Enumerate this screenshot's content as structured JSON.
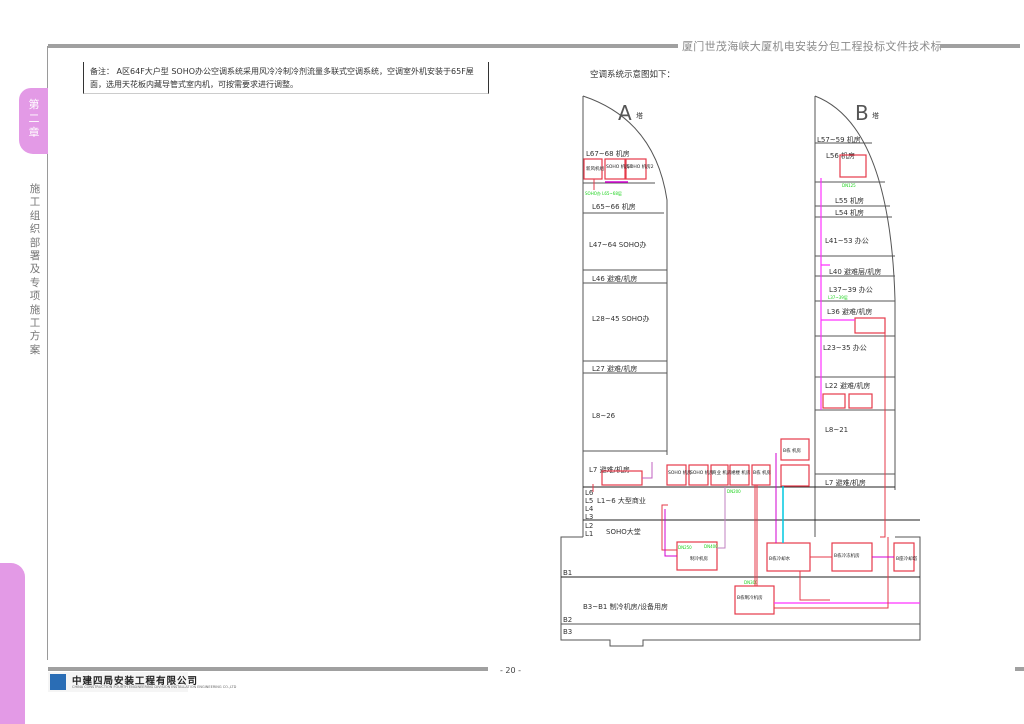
{
  "header": {
    "title": "厦门世茂海峡大厦机电安装分包工程投标文件技术标"
  },
  "sidebar": {
    "chapter": "第二章",
    "section": "施工组织部署及专项施工方案"
  },
  "note": "备注： A区64F大户型 SOHO办公空调系统采用风冷冷制冷剂流量多联式空调系统，空调室外机安装于65F屋面，选用天花板内藏导管式室内机，可按需要求进行调整。",
  "caption": "空调系统示意图如下：",
  "diagram": {
    "tower_a": {
      "letter": "A",
      "suffix": "塔",
      "floors": [
        "L67~68 机房",
        "L65~66 机房",
        "L47~64 SOHO办",
        "L46 避难/机房",
        "L28~45 SOHO办",
        "L27 避难/机房",
        "L8~26",
        "L7 避难/机房",
        "L6",
        "L5",
        "L4",
        "L3",
        "L2",
        "L1",
        "L1~6 大型商业",
        "SOHO大堂"
      ],
      "boxes": [
        "新风机组",
        "SOHO 机房7",
        "SOHO 机房2"
      ],
      "green": "SOHO办 L65~68层"
    },
    "tower_b": {
      "letter": "B",
      "suffix": "塔",
      "floors": [
        "L57~59 机房",
        "L56 机房",
        "L55 机房",
        "L54 机房",
        "L41~53 办公",
        "L40 避难层/机房",
        "L37~39 办公",
        "L36 避难/机房",
        "L23~35 办公",
        "L22 避难/机房",
        "L8~21",
        "L7 避难/机房"
      ],
      "labels": [
        "DN125",
        "L37~39层"
      ]
    },
    "podium_boxes": [
      "SOHO 机房",
      "SOHO 机房",
      "商业 机房",
      "裙楼 机房",
      "B栋 机房",
      "B栋 机房"
    ],
    "basement": {
      "floors": [
        "B1",
        "B3~B1 制冷机房/设备用房",
        "B2",
        "B3"
      ],
      "boxes": [
        "制冷机房",
        "B栋制冷机房",
        "B座冷却塔",
        "B栋冷却水",
        "B栋冷冻机房"
      ],
      "green": [
        "DN400",
        "DN300",
        "DN250",
        "DN200"
      ]
    }
  },
  "footer": {
    "page": "- 20 -",
    "company": "中建四局安装工程有限公司",
    "company_en": "CHINA CONSTRUCTION FOURTH ENGINEERING DIVISION INSTALLATION ENGINEERING CO.,LTD",
    "logo": "四局"
  }
}
